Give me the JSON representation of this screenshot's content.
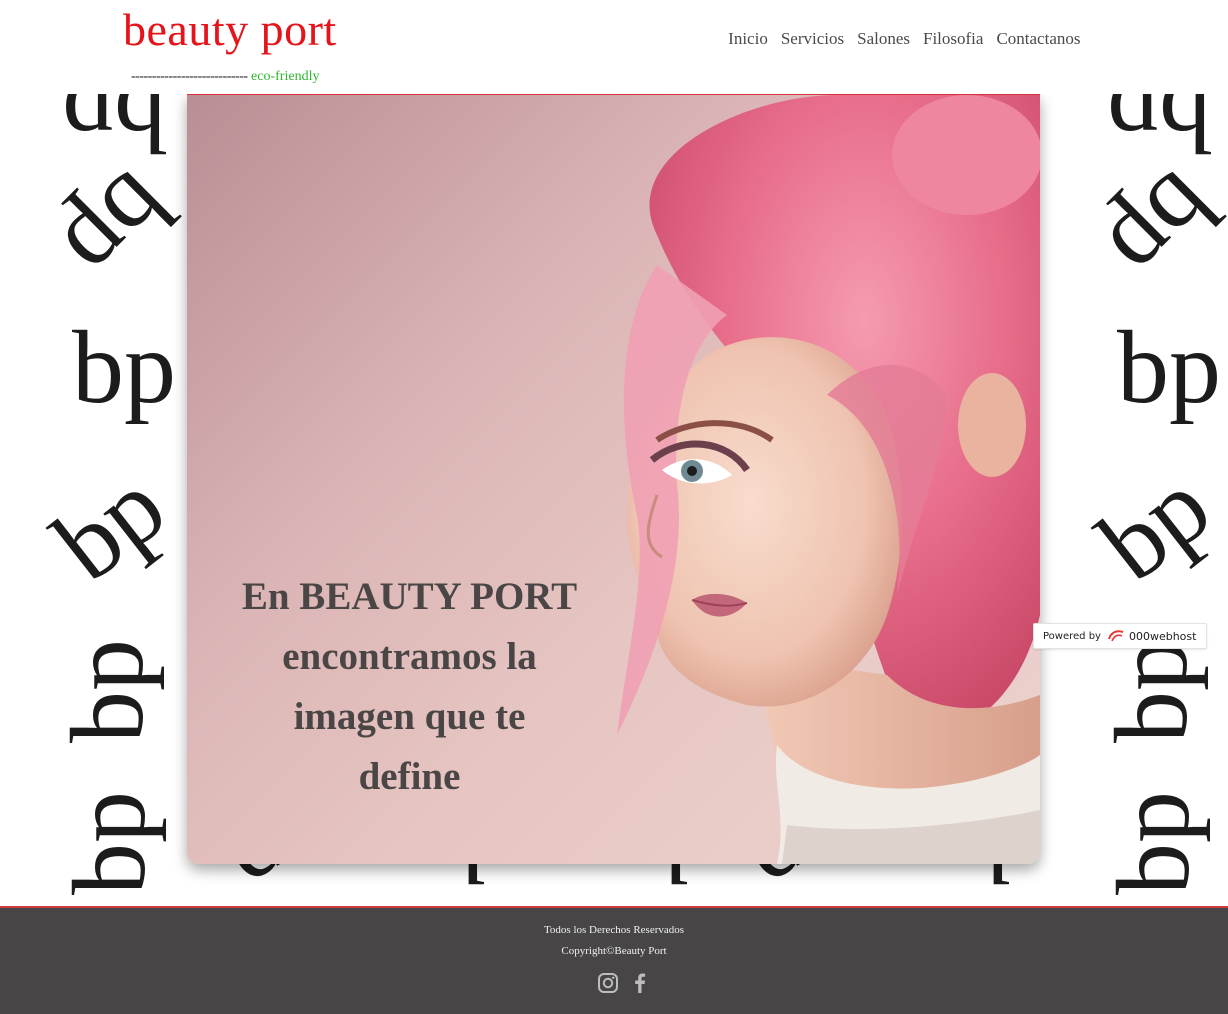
{
  "header": {
    "logo": "beauty port",
    "tagline_dashes": "----------------------------",
    "tagline_text": "eco-friendly",
    "nav": [
      "Inicio",
      "Servicios",
      "Salones",
      "Filosofia",
      "Contactanos"
    ]
  },
  "pattern": {
    "monogram": "bp"
  },
  "hero": {
    "lines": [
      "En BEAUTY PORT",
      "encontramos la",
      "imagen que te",
      "define"
    ]
  },
  "badge": {
    "powered": "Powered by",
    "host": "000webhost"
  },
  "footer": {
    "rights": "Todos los Derechos Reservados",
    "copyright": "Copyright©Beauty Port",
    "social": [
      "instagram-icon",
      "facebook-icon"
    ]
  },
  "colors": {
    "brand": "#e5141b",
    "eco": "#2fb62f",
    "footer_bg": "#474545",
    "accent_line": "#cf3a40"
  }
}
